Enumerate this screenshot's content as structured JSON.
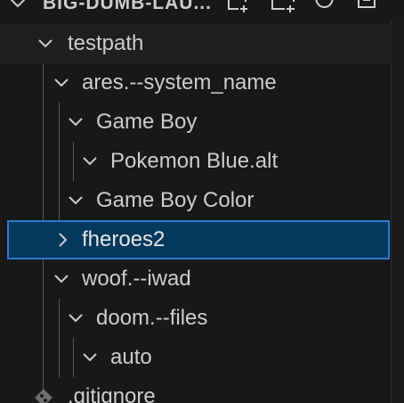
{
  "section": {
    "title": "BIG-DUMB-LAU...",
    "actions": [
      "new-file-icon",
      "new-folder-icon",
      "refresh-icon",
      "collapse-all-icon"
    ]
  },
  "tree": {
    "root": {
      "label": "testpath",
      "state": "expanded"
    },
    "items": [
      {
        "label": "ares.--system_name",
        "state": "expanded"
      },
      {
        "label": "Game Boy",
        "state": "expanded"
      },
      {
        "label": "Pokemon Blue.alt",
        "state": "expanded"
      },
      {
        "label": "Game Boy Color",
        "state": "expanded"
      },
      {
        "label": "fheroes2",
        "state": "collapsed",
        "selected": true
      },
      {
        "label": "woof.--iwad",
        "state": "expanded"
      },
      {
        "label": "doom.--files",
        "state": "expanded"
      },
      {
        "label": "auto",
        "state": "expanded"
      },
      {
        "label": ".gitignore",
        "icon": "git-icon"
      }
    ]
  },
  "colors": {
    "background": "#181818",
    "selected_bg": "#04395e",
    "selected_border": "#2b79d0",
    "text": "#cccccc",
    "git_icon": "#6e6e6e"
  }
}
